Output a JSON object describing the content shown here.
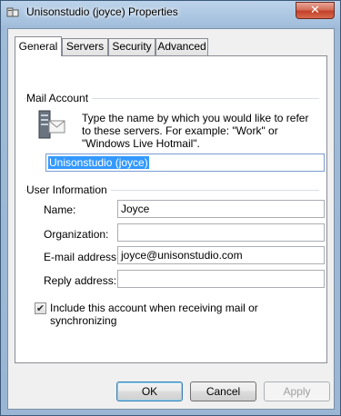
{
  "window": {
    "title": "Unisonstudio (joyce) Properties",
    "close_glyph": "✕"
  },
  "tabs": [
    {
      "label": "General",
      "active": true
    },
    {
      "label": "Servers",
      "active": false
    },
    {
      "label": "Security",
      "active": false
    },
    {
      "label": "Advanced",
      "active": false
    }
  ],
  "mail_account": {
    "group_label": "Mail Account",
    "description": "Type the name by which you would like to refer to these servers.  For example: \"Work\" or \"Windows Live Hotmail\".",
    "account_name": "Unisonstudio (joyce)",
    "icon": "server-mail-icon"
  },
  "user_information": {
    "group_label": "User Information",
    "name_label": "Name:",
    "name_value": "Joyce",
    "organization_label": "Organization:",
    "organization_value": "",
    "email_label": "E-mail address:",
    "email_value": "joyce@unisonstudio.com",
    "reply_label": "Reply address:",
    "reply_value": ""
  },
  "include_checkbox": {
    "label": "Include this account when receiving mail or synchronizing",
    "checked": true,
    "glyph": "✔"
  },
  "buttons": {
    "ok": "OK",
    "cancel": "Cancel",
    "apply": "Apply"
  },
  "colors": {
    "selection": "#3399ff",
    "close_button": "#c2412a"
  }
}
